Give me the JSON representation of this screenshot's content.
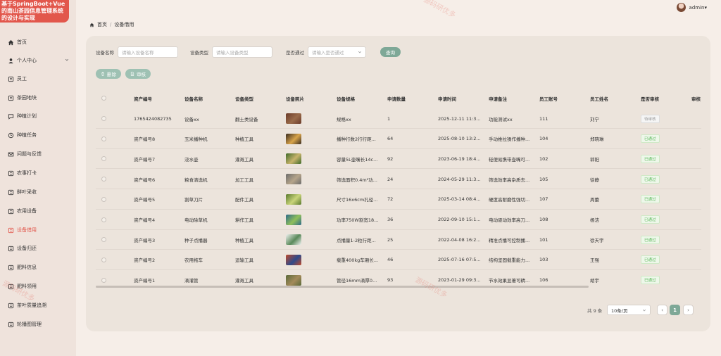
{
  "app": {
    "title_lines": [
      "基于SpringBoot+Vue",
      "的南山茶园信息管理系统",
      "的设计与实现"
    ]
  },
  "header": {
    "user": "admin",
    "caret": "▾"
  },
  "breadcrumb": {
    "home": "首页",
    "separator": "/",
    "current": "设备借用"
  },
  "sidebar": {
    "items": [
      {
        "label": "首页",
        "icon": "home-icon"
      },
      {
        "label": "个人中心",
        "icon": "user-icon"
      },
      {
        "label": "员工",
        "icon": "employee-icon"
      },
      {
        "label": "茶园地块",
        "icon": "plot-icon"
      },
      {
        "label": "种植计划",
        "icon": "chat-icon"
      },
      {
        "label": "种植任务",
        "icon": "clock-icon"
      },
      {
        "label": "问题与反馈",
        "icon": "mail-icon"
      },
      {
        "label": "农事打卡",
        "icon": "card-icon"
      },
      {
        "label": "鲜叶采收",
        "icon": "harvest-icon"
      },
      {
        "label": "农用设备",
        "icon": "device-icon"
      },
      {
        "label": "设备借用",
        "icon": "borrow-icon"
      },
      {
        "label": "设备归还",
        "icon": "return-icon"
      },
      {
        "label": "肥料信息",
        "icon": "fertilizer-icon"
      },
      {
        "label": "肥料领用",
        "icon": "fertilizer-use-icon"
      },
      {
        "label": "茶叶质量追溯",
        "icon": "trace-icon"
      },
      {
        "label": "轮播图管理",
        "icon": "carousel-icon"
      }
    ]
  },
  "filters": {
    "name_label": "设备名称",
    "name_placeholder": "请输入设备名称",
    "type_label": "设备类型",
    "type_placeholder": "请输入设备类型",
    "pass_label": "是否通过",
    "pass_placeholder": "请输入是否通过",
    "query_button": "查询"
  },
  "actions": {
    "delete": "删除",
    "review": "审核"
  },
  "table": {
    "columns": [
      "资产编号",
      "设备名称",
      "设备类型",
      "设备照片",
      "设备规格",
      "申请数量",
      "申请时间",
      "申请备注",
      "员工账号",
      "员工姓名",
      "是否审核",
      "审核"
    ],
    "rows": [
      {
        "asset": "1765424082735",
        "name": "设备xx",
        "type": "翻土类设备",
        "spec": "规格xx",
        "qty": "1",
        "time": "2025-12-11 11:3...",
        "note": "功能测试xx",
        "account": "111",
        "staff": "刘宁",
        "status": "待审核",
        "thumb": [
          "#6b3b2a",
          "#9a6b4a"
        ]
      },
      {
        "asset": "资产编号8",
        "name": "玉米播种机",
        "type": "种植工具",
        "spec": "播种行数2行行距...",
        "qty": "64",
        "time": "2025-08-10 13:2...",
        "note": "手动推拉操作播种...",
        "account": "104",
        "staff": "郑晓琳",
        "status": "已通过",
        "thumb": [
          "#3a2c20",
          "#d9a44a"
        ]
      },
      {
        "asset": "资产编号7",
        "name": "浇水壶",
        "type": "灌溉工具",
        "spec": "容量5L壶嘴长14c...",
        "qty": "92",
        "time": "2023-06-19 18:4...",
        "note": "轻便易携带壶嘴可...",
        "account": "102",
        "staff": "郭阳",
        "status": "已通过",
        "thumb": [
          "#3f6b2a",
          "#c7b36b"
        ]
      },
      {
        "asset": "资产编号6",
        "name": "粮食清选机",
        "type": "加工工具",
        "spec": "筛选面积0.4m²功...",
        "qty": "24",
        "time": "2024-05-29 11:3...",
        "note": "筛选效率高杂质去...",
        "account": "105",
        "staff": "徐静",
        "status": "已通过",
        "thumb": [
          "#6c6c6c",
          "#b5a48a"
        ]
      },
      {
        "asset": "资产编号5",
        "name": "割草刀片",
        "type": "配件工具",
        "spec": "尺寸16x6cm孔径...",
        "qty": "72",
        "time": "2025-03-14 08:4...",
        "note": "硬度高耐磨性强切...",
        "account": "107",
        "staff": "周蕾",
        "status": "已通过",
        "thumb": [
          "#5a7a2e",
          "#c9d47a"
        ]
      },
      {
        "asset": "资产编号4",
        "name": "电动除草机",
        "type": "耕作工具",
        "spec": "功率750W割宽18...",
        "qty": "36",
        "time": "2022-09-10 15:1...",
        "note": "电动驱动效率高刀...",
        "account": "108",
        "staff": "杨洁",
        "status": "已通过",
        "thumb": [
          "#2e6a8a",
          "#8fbf5a"
        ]
      },
      {
        "asset": "资产编号3",
        "name": "种子点播器",
        "type": "种植工具",
        "spec": "点播量1-2粒行距...",
        "qty": "25",
        "time": "2022-04-08 16:2...",
        "note": "精准点播可控制播...",
        "account": "101",
        "staff": "徐天宇",
        "status": "已通过",
        "thumb": [
          "#f0f0f0",
          "#5a8a5a"
        ]
      },
      {
        "asset": "资产编号2",
        "name": "农用拖车",
        "type": "运输工具",
        "spec": "载重400kg车厢长...",
        "qty": "46",
        "time": "2025-07-16 07:5...",
        "note": "结构坚固载重能力...",
        "account": "103",
        "staff": "王强",
        "status": "已通过",
        "thumb": [
          "#c04a2a",
          "#2e4a8a"
        ]
      },
      {
        "asset": "资产编号1",
        "name": "滴灌管",
        "type": "灌溉工具",
        "spec": "管径16mm滴厚0...",
        "qty": "93",
        "time": "2023-01-29 09:3...",
        "note": "节水效果显著可精...",
        "account": "106",
        "staff": "胡宇",
        "status": "已通过",
        "thumb": [
          "#5a6a3a",
          "#a48a5a"
        ]
      }
    ]
  },
  "pagination": {
    "total": "共 9 条",
    "page_size": "10条/页",
    "current": "1",
    "prev": "‹",
    "next": "›"
  },
  "watermarks": [
    "源码研优多",
    "源码研优多",
    "源码研优多"
  ]
}
